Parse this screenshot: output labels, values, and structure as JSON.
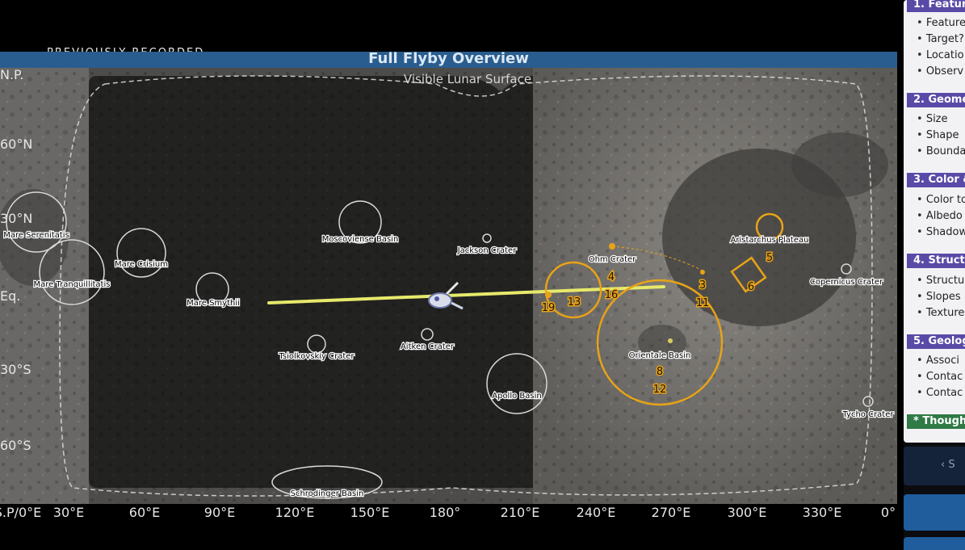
{
  "overlay": {
    "recorded_label": "PREVIOUSLY RECORDED"
  },
  "map": {
    "title": "Full Flyby Overview",
    "subtitle": "Visible Lunar Surface",
    "longitude_ticks": [
      "S.P/0°E",
      "30°E",
      "60°E",
      "90°E",
      "120°E",
      "150°E",
      "180°",
      "210°E",
      "240°E",
      "270°E",
      "300°E",
      "330°E",
      "0°"
    ],
    "latitude_ticks": [
      "N.P.",
      "60°N",
      "30°N",
      "Eq.",
      "30°S",
      "60°S"
    ],
    "features": [
      {
        "name": "Mare Serenitatis"
      },
      {
        "name": "Mare Crisium"
      },
      {
        "name": "Mare Tranquillitatis"
      },
      {
        "name": "Mare Smythii"
      },
      {
        "name": "Moscoviense Basin"
      },
      {
        "name": "Jackson Crater"
      },
      {
        "name": "Tsiolkovskiy Crater"
      },
      {
        "name": "Aitken Crater"
      },
      {
        "name": "Apollo Basin"
      },
      {
        "name": "Schrodinger Basin"
      },
      {
        "name": "Ohm Crater"
      },
      {
        "name": "Orientale Basin"
      },
      {
        "name": "Aristarchus Plateau"
      },
      {
        "name": "Copernicus Crater"
      },
      {
        "name": "Tycho Crater"
      }
    ],
    "target_numbers": [
      "19",
      "13",
      "4",
      "16",
      "3",
      "11",
      "8",
      "12",
      "5",
      "6"
    ],
    "colors": {
      "target": "#e8a317",
      "track": "#e6e96a",
      "title_bar": "#2a5d8f"
    }
  },
  "sidebar": {
    "sections": [
      {
        "title": "1. Feature",
        "items": [
          "Feature",
          "Target?",
          "Locatio",
          "Observ"
        ]
      },
      {
        "title": "2. Geome",
        "items": [
          "Size",
          "Shape",
          "Bounda"
        ]
      },
      {
        "title": "3. Color &",
        "items": [
          "Color to",
          "Albedo",
          "Shadow"
        ]
      },
      {
        "title": "4. Structu",
        "items": [
          "Structu",
          "Slopes",
          "Texture"
        ]
      },
      {
        "title": "5. Geolog",
        "items": [
          "Associ",
          "Contac",
          "Contac"
        ]
      },
      {
        "title": "* Though",
        "items": []
      }
    ],
    "nav_label": "‹ S"
  }
}
